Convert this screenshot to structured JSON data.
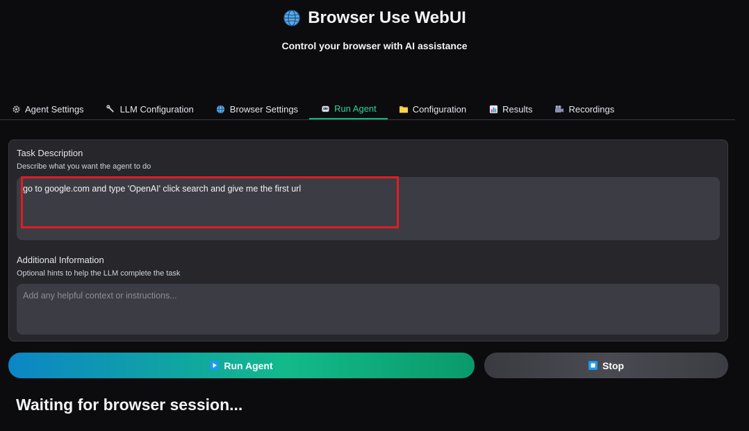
{
  "header": {
    "title": "Browser Use WebUI",
    "subtitle": "Control your browser with AI assistance",
    "icon": "globe-icon"
  },
  "tabs": [
    {
      "label": "Agent Settings",
      "icon": "gear-icon",
      "active": false
    },
    {
      "label": "LLM Configuration",
      "icon": "wrench-icon",
      "active": false
    },
    {
      "label": "Browser Settings",
      "icon": "globe-icon",
      "active": false
    },
    {
      "label": "Run Agent",
      "icon": "robot-icon",
      "active": true
    },
    {
      "label": "Configuration",
      "icon": "folder-icon",
      "active": false
    },
    {
      "label": "Results",
      "icon": "bar-chart-icon",
      "active": false
    },
    {
      "label": "Recordings",
      "icon": "camera-icon",
      "active": false
    }
  ],
  "task": {
    "label": "Task Description",
    "info": "Describe what you want the agent to do",
    "value": "go to google.com and type 'OpenAI' click search and give me the first url"
  },
  "additional": {
    "label": "Additional Information",
    "info": "Optional hints to help the LLM complete the task",
    "placeholder": "Add any helpful context or instructions..."
  },
  "buttons": {
    "run_label": "Run Agent",
    "stop_label": "Stop"
  },
  "status": {
    "text": "Waiting for browser session..."
  },
  "colors": {
    "accent": "#10b981",
    "highlight": "#e11d24",
    "background": "#0c0c0f",
    "panel": "#26262b"
  }
}
